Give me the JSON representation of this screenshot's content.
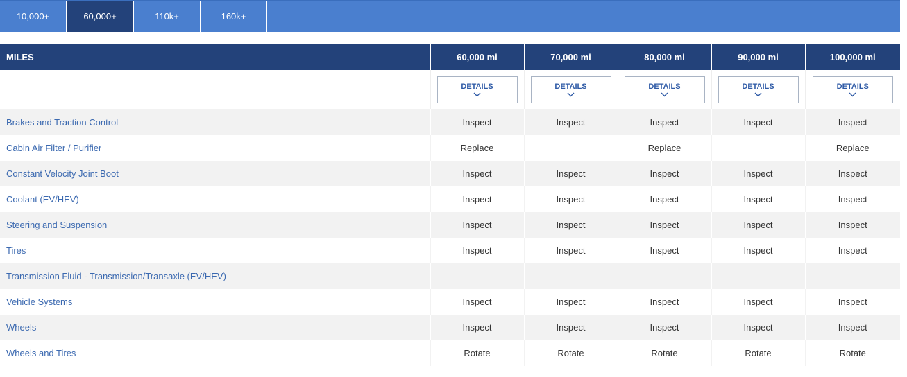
{
  "tabs": [
    {
      "label": "10,000+",
      "active": false
    },
    {
      "label": "60,000+",
      "active": true
    },
    {
      "label": "110k+",
      "active": false
    },
    {
      "label": "160k+",
      "active": false
    }
  ],
  "table": {
    "header_label": "MILES",
    "columns": [
      "60,000 mi",
      "70,000 mi",
      "80,000 mi",
      "90,000 mi",
      "100,000 mi"
    ],
    "details_label": "DETAILS",
    "rows": [
      {
        "item": "Brakes and Traction Control",
        "values": [
          "Inspect",
          "Inspect",
          "Inspect",
          "Inspect",
          "Inspect"
        ]
      },
      {
        "item": "Cabin Air Filter / Purifier",
        "values": [
          "Replace",
          "",
          "Replace",
          "",
          "Replace"
        ]
      },
      {
        "item": "Constant Velocity Joint Boot",
        "values": [
          "Inspect",
          "Inspect",
          "Inspect",
          "Inspect",
          "Inspect"
        ]
      },
      {
        "item": "Coolant (EV/HEV)",
        "values": [
          "Inspect",
          "Inspect",
          "Inspect",
          "Inspect",
          "Inspect"
        ]
      },
      {
        "item": "Steering and Suspension",
        "values": [
          "Inspect",
          "Inspect",
          "Inspect",
          "Inspect",
          "Inspect"
        ]
      },
      {
        "item": "Tires",
        "values": [
          "Inspect",
          "Inspect",
          "Inspect",
          "Inspect",
          "Inspect"
        ]
      },
      {
        "item": "Transmission Fluid - Transmission/Transaxle (EV/HEV)",
        "values": [
          "",
          "",
          "",
          "",
          ""
        ]
      },
      {
        "item": "Vehicle Systems",
        "values": [
          "Inspect",
          "Inspect",
          "Inspect",
          "Inspect",
          "Inspect"
        ]
      },
      {
        "item": "Wheels",
        "values": [
          "Inspect",
          "Inspect",
          "Inspect",
          "Inspect",
          "Inspect"
        ]
      },
      {
        "item": "Wheels and Tires",
        "values": [
          "Rotate",
          "Rotate",
          "Rotate",
          "Rotate",
          "Rotate"
        ]
      }
    ]
  }
}
